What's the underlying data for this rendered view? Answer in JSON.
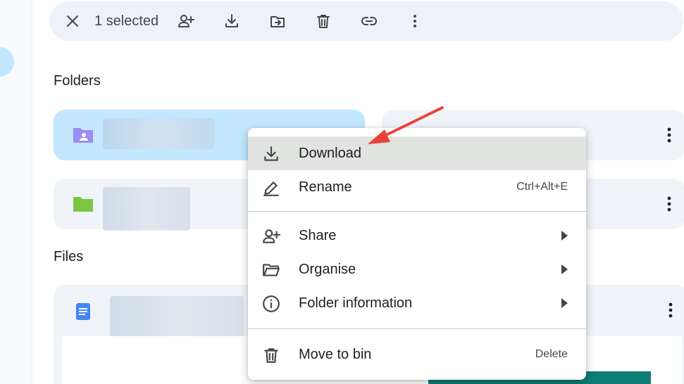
{
  "toolbar": {
    "selected_text": "1 selected",
    "actions": [
      "close-icon",
      "share-icon",
      "download-icon",
      "move-icon",
      "delete-icon",
      "copy-link-icon",
      "more-icon"
    ]
  },
  "sections": {
    "folders_title": "Folders",
    "files_title": "Files"
  },
  "menu": {
    "download": "Download",
    "rename": "Rename",
    "rename_shortcut": "Ctrl+Alt+E",
    "share": "Share",
    "organise": "Organise",
    "folder_information": "Folder information",
    "move_to_bin": "Move to bin",
    "move_to_bin_shortcut": "Delete"
  },
  "colors": {
    "selected_card": "#c2e7ff",
    "card": "#f0f4f9",
    "menu_hover": "#e1e3e1",
    "annotation_arrow": "#ea4335",
    "folder_shared": "#9c8cf5",
    "folder_green": "#7cc542",
    "doc_blue": "#4285f4"
  }
}
